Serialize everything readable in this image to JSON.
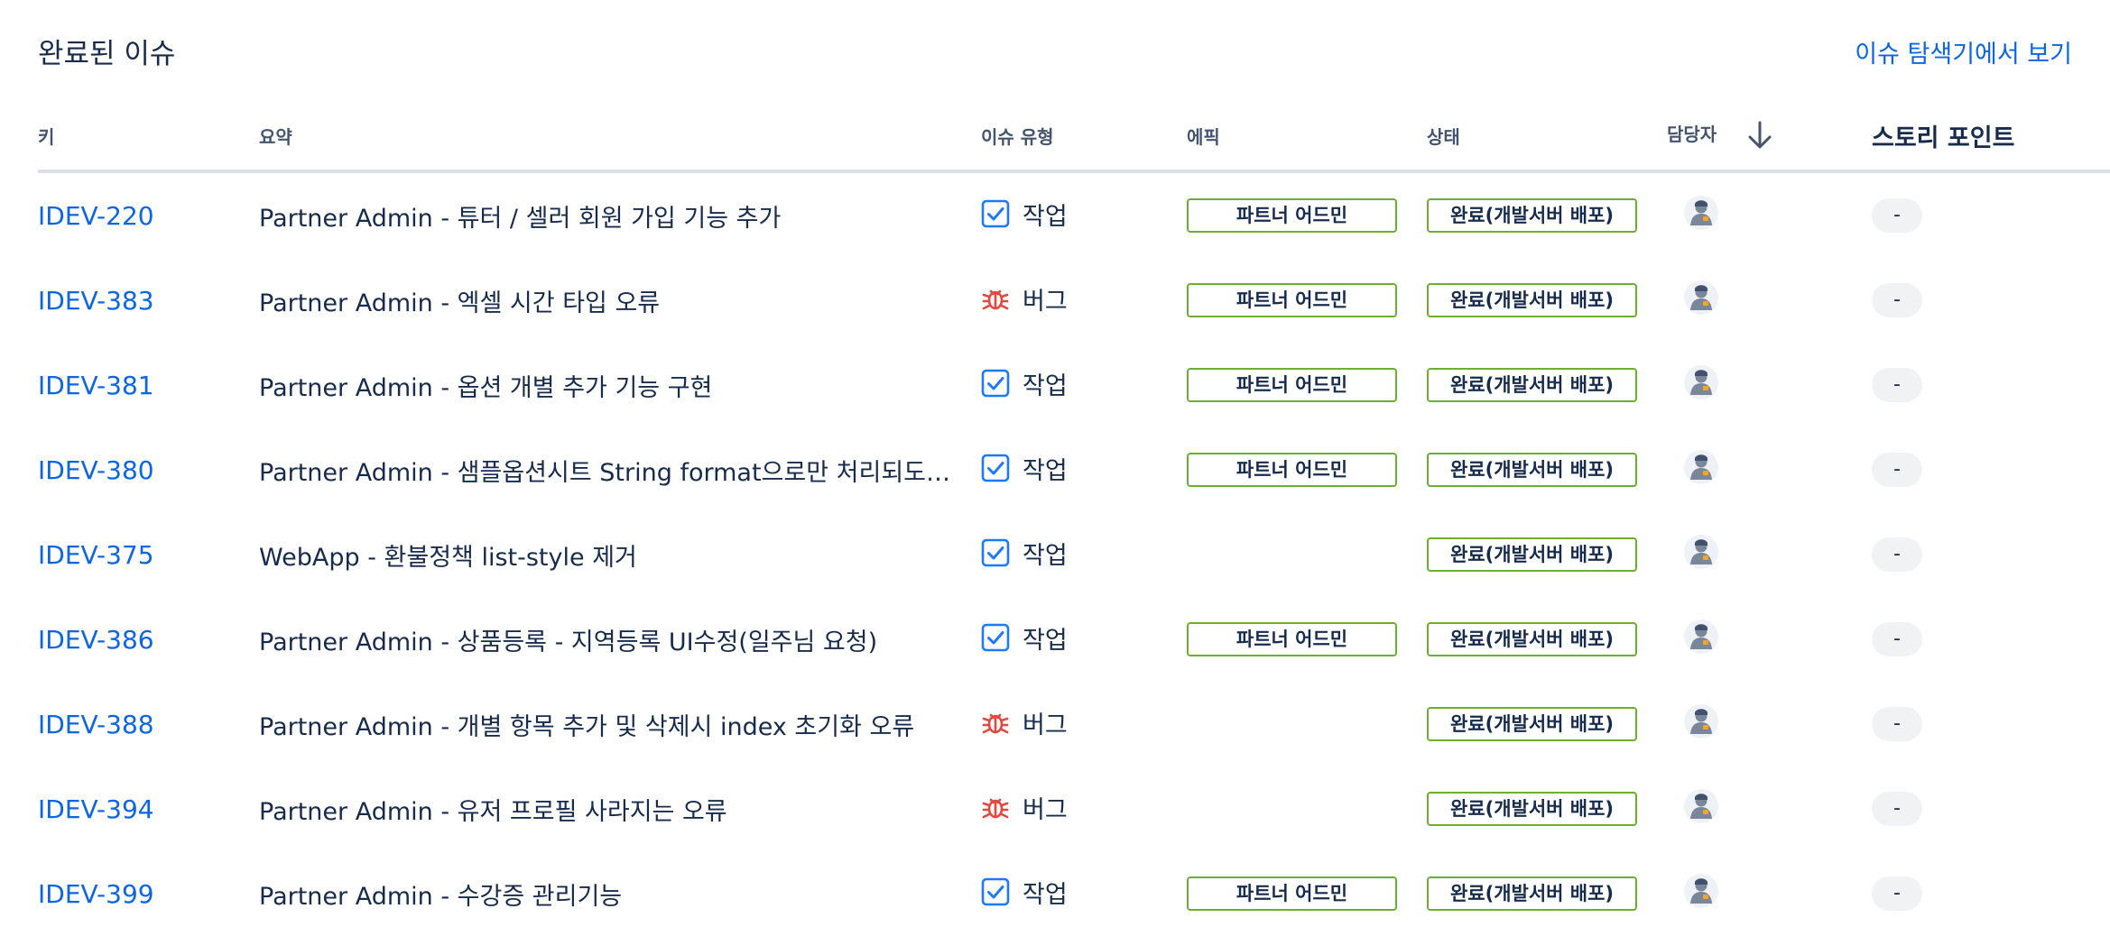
{
  "header": {
    "title": "완료된 이슈",
    "explorer_link": "이슈 탐색기에서 보기"
  },
  "columns": {
    "key": "키",
    "summary": "요약",
    "type": "이슈 유형",
    "epic": "에픽",
    "status": "상태",
    "assignee": "담당자",
    "story_points": "스토리 포인트"
  },
  "sort": {
    "column": "assignee",
    "direction": "descending",
    "icon": "arrow-down-icon"
  },
  "icons": {
    "task": "checkbox-checked-icon",
    "bug": "bug-icon",
    "assignee": "avatar-icon"
  },
  "colors": {
    "link": "#0c66e4",
    "lozenge_border": "#6cae2f",
    "task_icon": "#1d7afc",
    "bug_icon": "#e2483d",
    "sp_pill_bg": "#f1f2f4"
  },
  "issues": [
    {
      "key": "IDEV-220",
      "summary": "Partner Admin - 튜터 / 셀러 회원 가입 기능 추가",
      "type": "작업",
      "type_kind": "task",
      "epic": "파트너 어드민",
      "status": "완료(개발서버 배포)",
      "story_points": "-"
    },
    {
      "key": "IDEV-383",
      "summary": "Partner Admin - 엑셀 시간 타입 오류",
      "type": "버그",
      "type_kind": "bug",
      "epic": "파트너 어드민",
      "status": "완료(개발서버 배포)",
      "story_points": "-"
    },
    {
      "key": "IDEV-381",
      "summary": "Partner Admin - 옵션 개별 추가 기능 구현",
      "type": "작업",
      "type_kind": "task",
      "epic": "파트너 어드민",
      "status": "완료(개발서버 배포)",
      "story_points": "-"
    },
    {
      "key": "IDEV-380",
      "summary": "Partner Admin - 샘플옵션시트 String format으로만 처리되도록...",
      "type": "작업",
      "type_kind": "task",
      "epic": "파트너 어드민",
      "status": "완료(개발서버 배포)",
      "story_points": "-"
    },
    {
      "key": "IDEV-375",
      "summary": "WebApp - 환불정책 list-style 제거",
      "type": "작업",
      "type_kind": "task",
      "epic": "",
      "status": "완료(개발서버 배포)",
      "story_points": "-"
    },
    {
      "key": "IDEV-386",
      "summary": "Partner Admin - 상품등록 - 지역등록 UI수정(일주님 요청)",
      "type": "작업",
      "type_kind": "task",
      "epic": "파트너 어드민",
      "status": "완료(개발서버 배포)",
      "story_points": "-"
    },
    {
      "key": "IDEV-388",
      "summary": "Partner Admin - 개별 항목 추가 및 삭제시 index 초기화 오류",
      "type": "버그",
      "type_kind": "bug",
      "epic": "",
      "status": "완료(개발서버 배포)",
      "story_points": "-"
    },
    {
      "key": "IDEV-394",
      "summary": "Partner Admin - 유저 프로필 사라지는 오류",
      "type": "버그",
      "type_kind": "bug",
      "epic": "",
      "status": "완료(개발서버 배포)",
      "story_points": "-"
    },
    {
      "key": "IDEV-399",
      "summary": "Partner Admin - 수강증 관리기능",
      "type": "작업",
      "type_kind": "task",
      "epic": "파트너 어드민",
      "status": "완료(개발서버 배포)",
      "story_points": "-"
    }
  ]
}
